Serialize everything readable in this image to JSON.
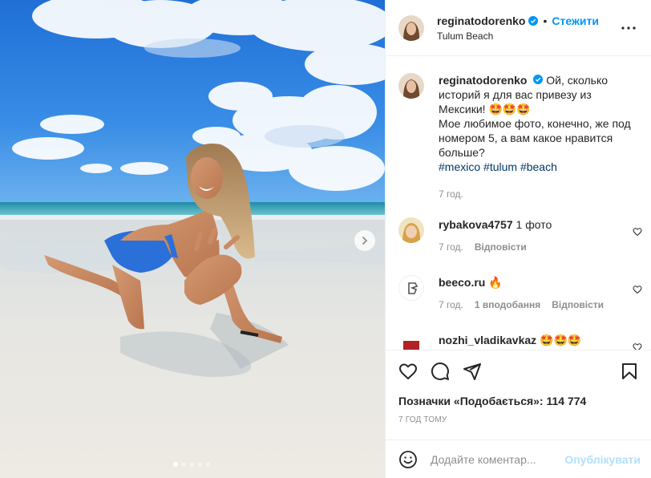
{
  "post": {
    "username": "reginatodorenko",
    "location": "Tulum Beach",
    "follow_label": "Стежити",
    "separator": "•",
    "verified_icon": "verified-badge-icon",
    "more_icon": "more-options-icon"
  },
  "carousel": {
    "total_slides": 5,
    "current_slide": 1,
    "next_icon": "chevron-right-icon"
  },
  "caption": {
    "username": "reginatodorenko",
    "text_line1": "Ой, сколько историй я для вас привезу из Мексики!",
    "emojis": "🤩🤩🤩",
    "text_line2": "Мое любимое фото, конечно, же под номером 5, а вам какое нравится больше?",
    "hashtags": [
      "#mexico",
      "#tulum",
      "#beach"
    ],
    "time": "7 год."
  },
  "comments": [
    {
      "username": "rybakova4757",
      "text": "1 фото",
      "time": "7 год.",
      "reply_label": "Відповісти",
      "likes_label": ""
    },
    {
      "username": "beeco.ru",
      "text": "🔥",
      "time": "7 год.",
      "reply_label": "Відповісти",
      "likes_label": "1 вподобання"
    },
    {
      "username": "nozhi_vladikavkaz",
      "text": "🤩🤩🤩",
      "time": "",
      "reply_label": "",
      "likes_label": ""
    }
  ],
  "actions": {
    "like_icon": "heart-icon",
    "comment_icon": "comment-icon",
    "share_icon": "share-icon",
    "save_icon": "bookmark-icon",
    "likes_text": "Позначки «Подобається»: 114 774",
    "posted_time": "7 ГОД ТОМУ"
  },
  "add_comment": {
    "placeholder": "Додайте коментар...",
    "publish_label": "Опублікувати",
    "emoji_icon": "emoji-smile-icon"
  },
  "colors": {
    "accent": "#0095f6",
    "publish_disabled": "#b2dffc",
    "hashtag": "#00376b",
    "muted": "#8e8e8e"
  }
}
